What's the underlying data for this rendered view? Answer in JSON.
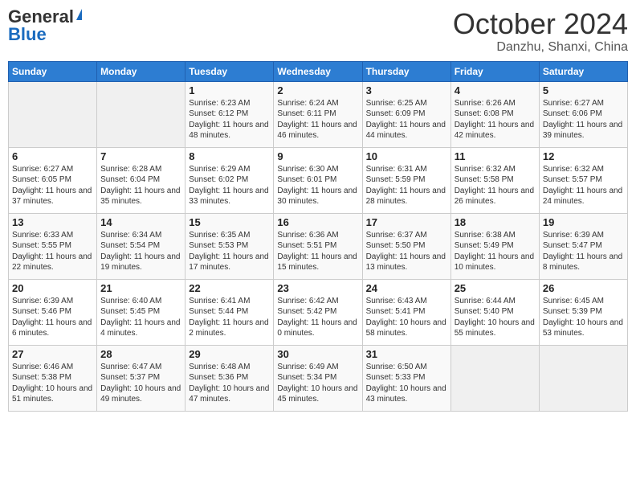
{
  "logo": {
    "general": "General",
    "blue": "Blue"
  },
  "title": {
    "month_year": "October 2024",
    "location": "Danzhu, Shanxi, China"
  },
  "weekdays": [
    "Sunday",
    "Monday",
    "Tuesday",
    "Wednesday",
    "Thursday",
    "Friday",
    "Saturday"
  ],
  "weeks": [
    [
      {
        "day": "",
        "info": ""
      },
      {
        "day": "",
        "info": ""
      },
      {
        "day": "1",
        "info": "Sunrise: 6:23 AM\nSunset: 6:12 PM\nDaylight: 11 hours and 48 minutes."
      },
      {
        "day": "2",
        "info": "Sunrise: 6:24 AM\nSunset: 6:11 PM\nDaylight: 11 hours and 46 minutes."
      },
      {
        "day": "3",
        "info": "Sunrise: 6:25 AM\nSunset: 6:09 PM\nDaylight: 11 hours and 44 minutes."
      },
      {
        "day": "4",
        "info": "Sunrise: 6:26 AM\nSunset: 6:08 PM\nDaylight: 11 hours and 42 minutes."
      },
      {
        "day": "5",
        "info": "Sunrise: 6:27 AM\nSunset: 6:06 PM\nDaylight: 11 hours and 39 minutes."
      }
    ],
    [
      {
        "day": "6",
        "info": "Sunrise: 6:27 AM\nSunset: 6:05 PM\nDaylight: 11 hours and 37 minutes."
      },
      {
        "day": "7",
        "info": "Sunrise: 6:28 AM\nSunset: 6:04 PM\nDaylight: 11 hours and 35 minutes."
      },
      {
        "day": "8",
        "info": "Sunrise: 6:29 AM\nSunset: 6:02 PM\nDaylight: 11 hours and 33 minutes."
      },
      {
        "day": "9",
        "info": "Sunrise: 6:30 AM\nSunset: 6:01 PM\nDaylight: 11 hours and 30 minutes."
      },
      {
        "day": "10",
        "info": "Sunrise: 6:31 AM\nSunset: 5:59 PM\nDaylight: 11 hours and 28 minutes."
      },
      {
        "day": "11",
        "info": "Sunrise: 6:32 AM\nSunset: 5:58 PM\nDaylight: 11 hours and 26 minutes."
      },
      {
        "day": "12",
        "info": "Sunrise: 6:32 AM\nSunset: 5:57 PM\nDaylight: 11 hours and 24 minutes."
      }
    ],
    [
      {
        "day": "13",
        "info": "Sunrise: 6:33 AM\nSunset: 5:55 PM\nDaylight: 11 hours and 22 minutes."
      },
      {
        "day": "14",
        "info": "Sunrise: 6:34 AM\nSunset: 5:54 PM\nDaylight: 11 hours and 19 minutes."
      },
      {
        "day": "15",
        "info": "Sunrise: 6:35 AM\nSunset: 5:53 PM\nDaylight: 11 hours and 17 minutes."
      },
      {
        "day": "16",
        "info": "Sunrise: 6:36 AM\nSunset: 5:51 PM\nDaylight: 11 hours and 15 minutes."
      },
      {
        "day": "17",
        "info": "Sunrise: 6:37 AM\nSunset: 5:50 PM\nDaylight: 11 hours and 13 minutes."
      },
      {
        "day": "18",
        "info": "Sunrise: 6:38 AM\nSunset: 5:49 PM\nDaylight: 11 hours and 10 minutes."
      },
      {
        "day": "19",
        "info": "Sunrise: 6:39 AM\nSunset: 5:47 PM\nDaylight: 11 hours and 8 minutes."
      }
    ],
    [
      {
        "day": "20",
        "info": "Sunrise: 6:39 AM\nSunset: 5:46 PM\nDaylight: 11 hours and 6 minutes."
      },
      {
        "day": "21",
        "info": "Sunrise: 6:40 AM\nSunset: 5:45 PM\nDaylight: 11 hours and 4 minutes."
      },
      {
        "day": "22",
        "info": "Sunrise: 6:41 AM\nSunset: 5:44 PM\nDaylight: 11 hours and 2 minutes."
      },
      {
        "day": "23",
        "info": "Sunrise: 6:42 AM\nSunset: 5:42 PM\nDaylight: 11 hours and 0 minutes."
      },
      {
        "day": "24",
        "info": "Sunrise: 6:43 AM\nSunset: 5:41 PM\nDaylight: 10 hours and 58 minutes."
      },
      {
        "day": "25",
        "info": "Sunrise: 6:44 AM\nSunset: 5:40 PM\nDaylight: 10 hours and 55 minutes."
      },
      {
        "day": "26",
        "info": "Sunrise: 6:45 AM\nSunset: 5:39 PM\nDaylight: 10 hours and 53 minutes."
      }
    ],
    [
      {
        "day": "27",
        "info": "Sunrise: 6:46 AM\nSunset: 5:38 PM\nDaylight: 10 hours and 51 minutes."
      },
      {
        "day": "28",
        "info": "Sunrise: 6:47 AM\nSunset: 5:37 PM\nDaylight: 10 hours and 49 minutes."
      },
      {
        "day": "29",
        "info": "Sunrise: 6:48 AM\nSunset: 5:36 PM\nDaylight: 10 hours and 47 minutes."
      },
      {
        "day": "30",
        "info": "Sunrise: 6:49 AM\nSunset: 5:34 PM\nDaylight: 10 hours and 45 minutes."
      },
      {
        "day": "31",
        "info": "Sunrise: 6:50 AM\nSunset: 5:33 PM\nDaylight: 10 hours and 43 minutes."
      },
      {
        "day": "",
        "info": ""
      },
      {
        "day": "",
        "info": ""
      }
    ]
  ]
}
